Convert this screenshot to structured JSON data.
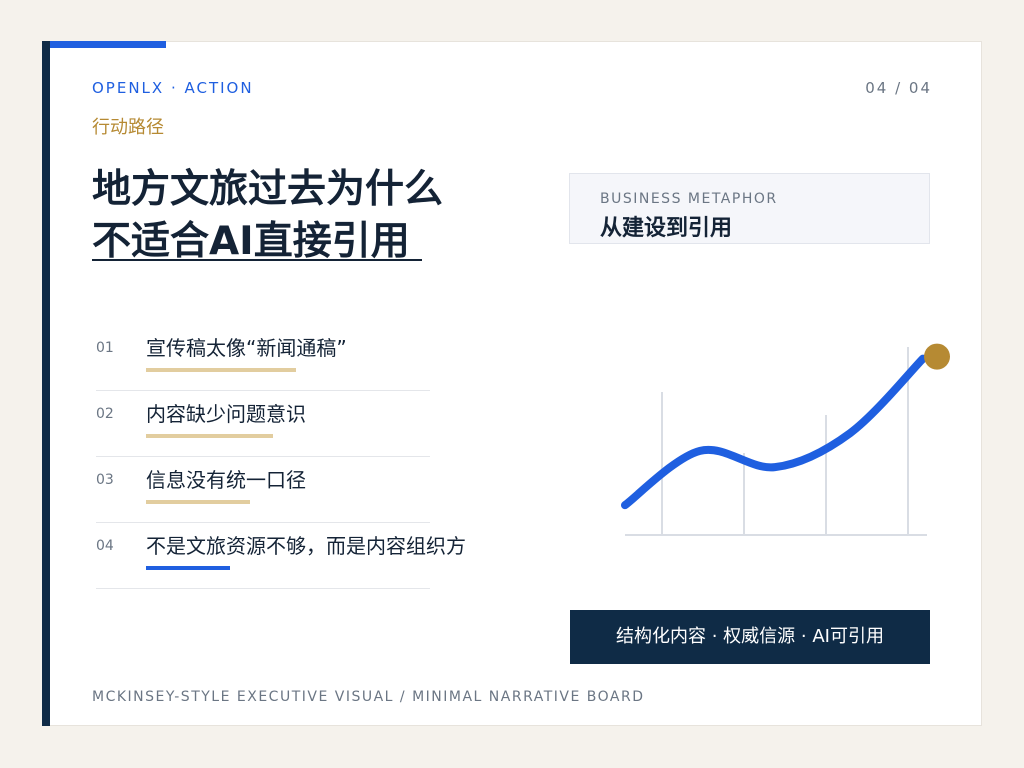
{
  "header": {
    "eyebrow": "OPENLX · ACTION",
    "page": "04 / 04",
    "kicker": "行动路径"
  },
  "title": {
    "line1": "地方文旅过去为什么",
    "line2": "不适合AI直接引用"
  },
  "metaphor": {
    "label": "BUSINESS METAPHOR",
    "title": "从建设到引用"
  },
  "items": [
    {
      "num": "01",
      "text": "宣传稿太像“新闻通稿”",
      "level": 0.45
    },
    {
      "num": "02",
      "text": "内容缺少问题意识",
      "level": 0.38
    },
    {
      "num": "03",
      "text": "信息没有统一口径",
      "level": 0.31
    },
    {
      "num": "04",
      "text": "不是文旅资源不够，而是内容组织方",
      "level": 0.25,
      "active": true
    }
  ],
  "chart_data": {
    "type": "line",
    "series": [
      {
        "values": [
          22,
          62,
          50,
          75,
          130
        ]
      }
    ],
    "gridlines": 4,
    "endpoint_marker": true
  },
  "footer": {
    "box": "结构化内容 · 权威信源 · AI可引用",
    "tag": "MCKINSEY-STYLE EXECUTIVE VISUAL / MINIMAL NARRATIVE BOARD"
  },
  "colors": {
    "navy": "#0f2b46",
    "blue": "#1f5fe0",
    "gold": "#b68a33",
    "sand": "#e2cd9f"
  }
}
